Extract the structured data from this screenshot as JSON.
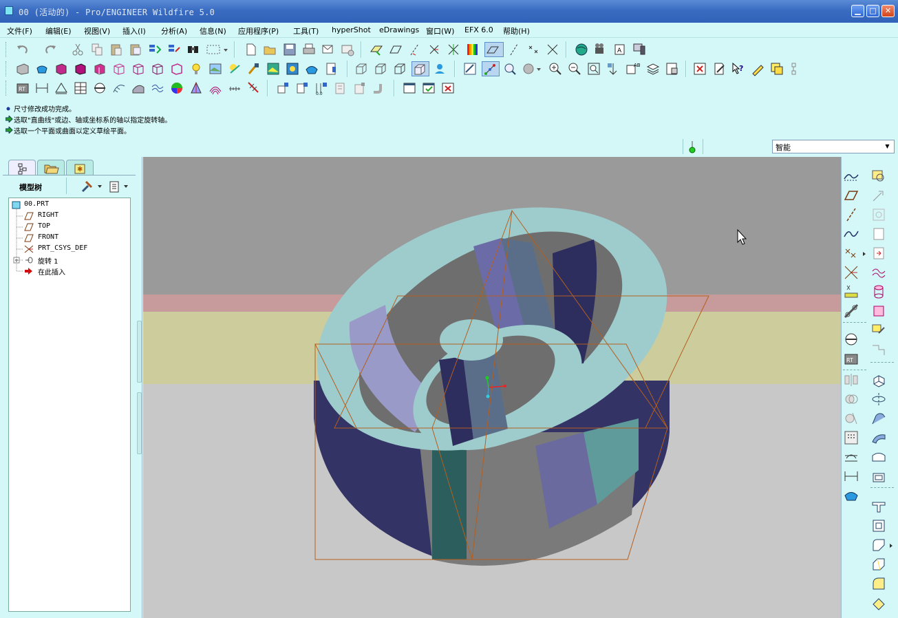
{
  "window": {
    "title": "00 (活动的) - Pro/ENGINEER Wildfire 5.0",
    "minimize_icon": "minimize-icon",
    "maximize_icon": "maximize-icon",
    "close_icon": "close-icon"
  },
  "menu": [
    {
      "label": "文件(F)"
    },
    {
      "label": "编辑(E)"
    },
    {
      "label": "视图(V)"
    },
    {
      "label": "插入(I)"
    },
    {
      "label": "分析(A)"
    },
    {
      "label": "信息(N)"
    },
    {
      "label": "应用程序(P)"
    },
    {
      "label": "工具(T)"
    },
    {
      "label": "hyperShot"
    },
    {
      "label": "eDrawings"
    },
    {
      "label": "窗口(W)"
    },
    {
      "label": "EFX 6.0"
    },
    {
      "label": "帮助(H)"
    }
  ],
  "messages": [
    {
      "icon": "info-dot-icon",
      "text": "尺寸修改成功完成。"
    },
    {
      "icon": "prompt-arrow-icon",
      "text": "选取\"直曲线\"或边、轴或坐标系的轴以指定旋转轴。"
    },
    {
      "icon": "prompt-arrow-icon",
      "text": "选取一个平面或曲面以定义草绘平面。"
    }
  ],
  "selection_filter": {
    "value": "智能"
  },
  "navigator": {
    "tree_label": "模型树",
    "tabs": [
      "model-tree-tab",
      "folder-browser-tab",
      "favorites-tab"
    ],
    "items": [
      {
        "label": "00.PRT",
        "icon": "part-icon"
      },
      {
        "label": "RIGHT",
        "icon": "datum-plane-icon"
      },
      {
        "label": "TOP",
        "icon": "datum-plane-icon"
      },
      {
        "label": "FRONT",
        "icon": "datum-plane-icon"
      },
      {
        "label": "PRT_CSYS_DEF",
        "icon": "csys-icon"
      },
      {
        "label": "旋转 1",
        "icon": "revolve-icon"
      },
      {
        "label": "在此插入",
        "icon": "insert-here-arrow-icon"
      }
    ]
  },
  "colors": {
    "ui_background": "#d4f7f7",
    "titlebar": "#2f62b8",
    "model_light": "#9ecccc",
    "model_dark": "#333366",
    "model_mid": "#6e6e6e",
    "datum_plane": "#b45f1e"
  }
}
